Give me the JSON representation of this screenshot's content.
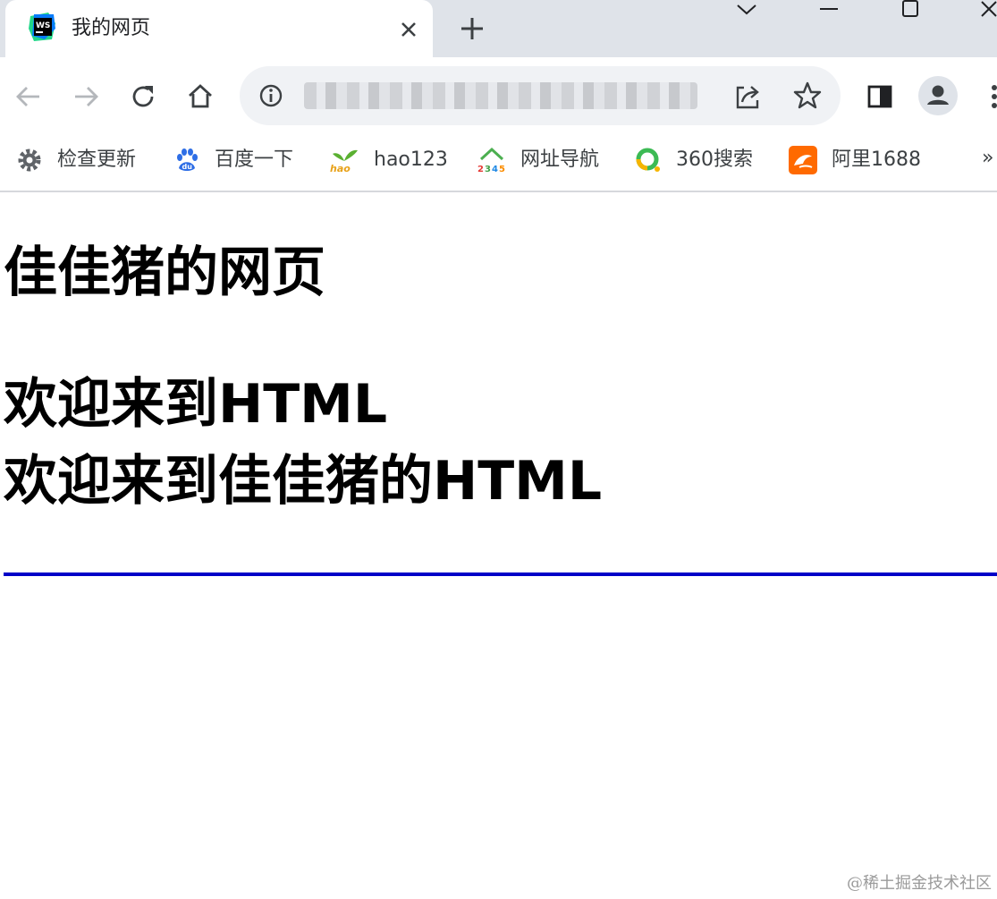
{
  "tab": {
    "title": "我的网页",
    "favicon": "webstorm-icon"
  },
  "omnibox": {
    "url": ""
  },
  "bookmarks": [
    {
      "label": "检查更新",
      "icon": "gear-icon"
    },
    {
      "label": "百度一下",
      "icon": "baidu-icon"
    },
    {
      "label": "hao123",
      "icon": "hao123-icon"
    },
    {
      "label": "网址导航",
      "icon": "2345-icon"
    },
    {
      "label": "360搜索",
      "icon": "360-icon"
    },
    {
      "label": "阿里1688",
      "icon": "alibaba-1688-icon"
    }
  ],
  "bookmarks_more": "»",
  "page": {
    "h1": "佳佳猪的网页",
    "h2_1": "欢迎来到HTML",
    "h2_2": "欢迎来到佳佳猪的HTML"
  },
  "watermark": "@稀土掘金技术社区",
  "colors": {
    "rule": "#0000c8",
    "tabstrip": "#dfe3e9",
    "omnibox": "#f0f2f5"
  }
}
